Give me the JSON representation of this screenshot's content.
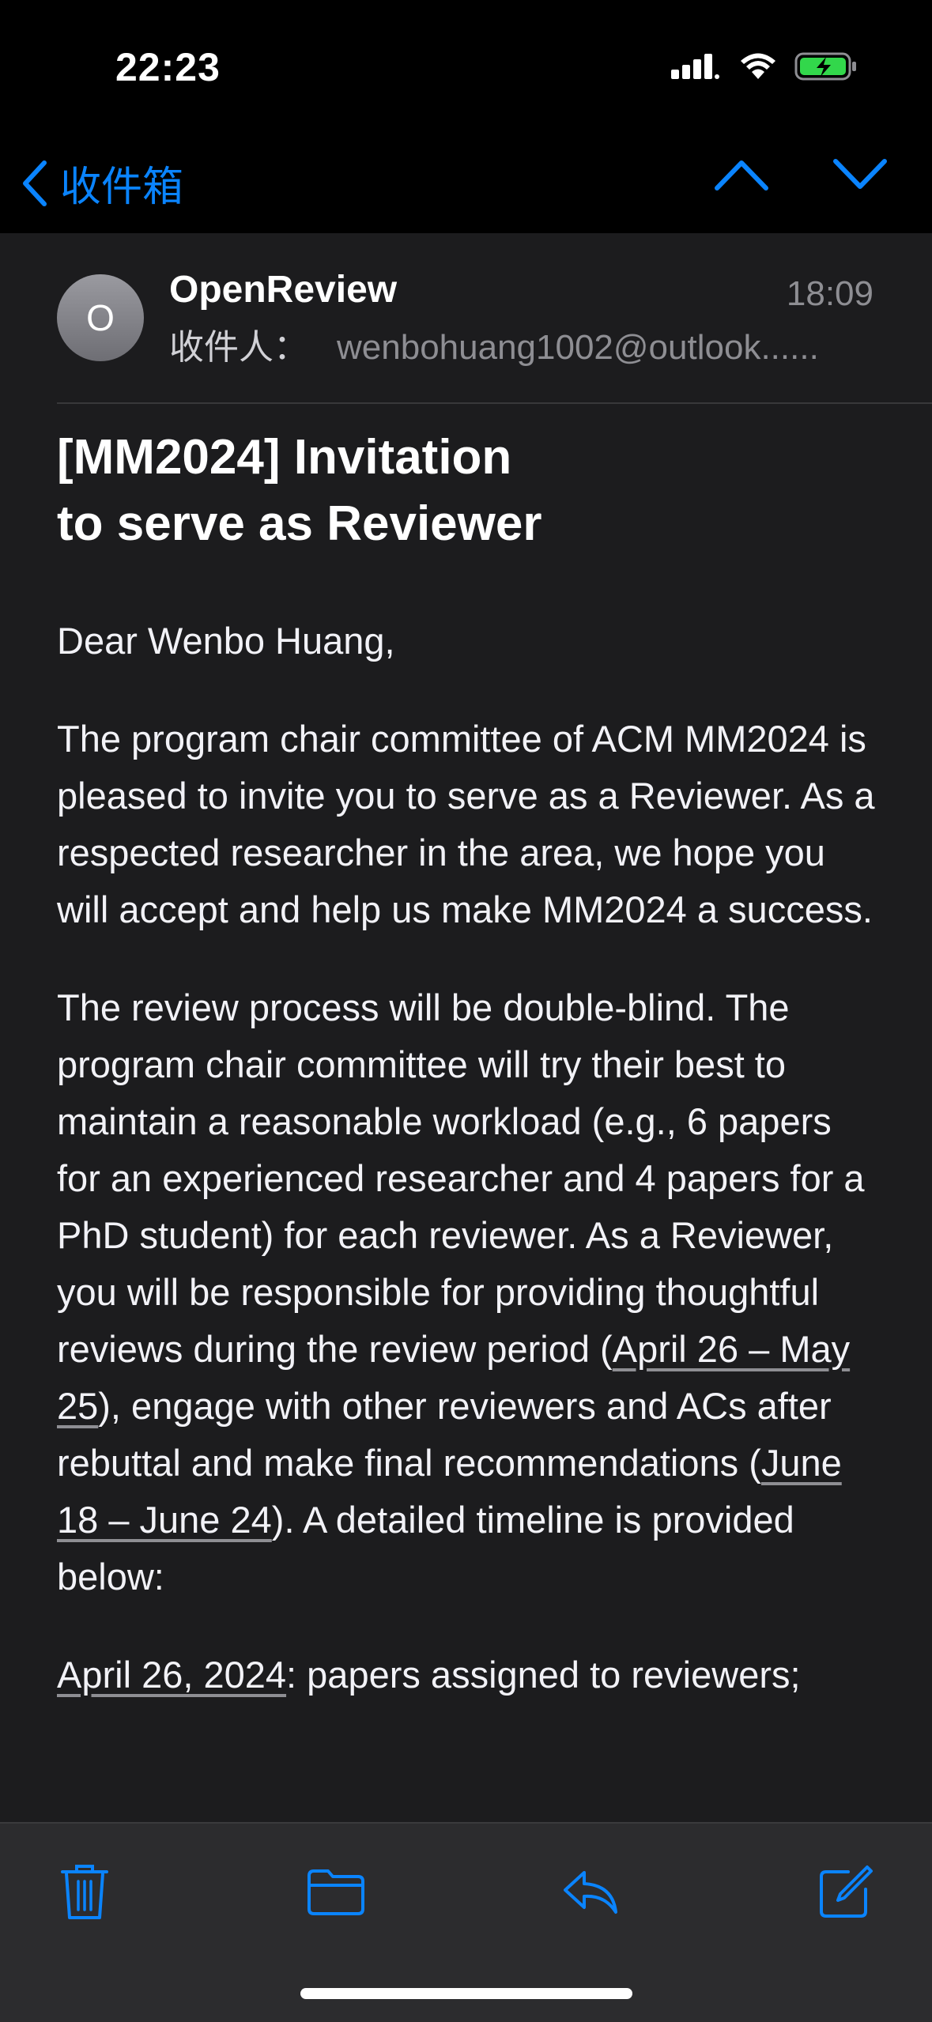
{
  "status_bar": {
    "time": "22:23"
  },
  "nav": {
    "back_label": "收件箱"
  },
  "message": {
    "avatar_initial": "O",
    "sender": "OpenReview",
    "time": "18:09",
    "recipient_label": "收件人：",
    "recipient_address": "wenbohuang1002@outlook......",
    "subject_line1": "[MM2024] Invitation",
    "subject_line2": "to serve as Reviewer"
  },
  "body": {
    "greeting": "Dear Wenbo Huang,",
    "para1": "The program chair committee of ACM MM2024 is pleased to invite you to serve as a Reviewer. As a respected researcher in the area, we hope you will accept and help us make MM2024 a success.",
    "para2_a": "The review process will be double-blind. The program chair committee will try their best to maintain a reasonable workload (e.g., 6 papers for an experienced researcher and 4 papers for a PhD student) for each reviewer. As a Reviewer, you will be responsible for providing thoughtful reviews during the review period (",
    "para2_link1": "April 26 – May 25",
    "para2_b": "), engage with other reviewers and ACs after rebuttal and make final recommendations (",
    "para2_link2": "June 18 – June 24",
    "para2_c": "). A detailed timeline is provided below:",
    "timeline_date": "April 26, 2024",
    "timeline_text": ": papers assigned to reviewers;"
  },
  "colors": {
    "accent": "#0a84ff",
    "background": "#1c1c1e",
    "toolbar": "#2c2c2e"
  },
  "icons": [
    "chevron-left-icon",
    "chevron-up-icon",
    "chevron-down-icon",
    "trash-icon",
    "folder-icon",
    "reply-icon",
    "compose-icon",
    "signal-icon",
    "wifi-icon",
    "battery-charging-icon"
  ]
}
